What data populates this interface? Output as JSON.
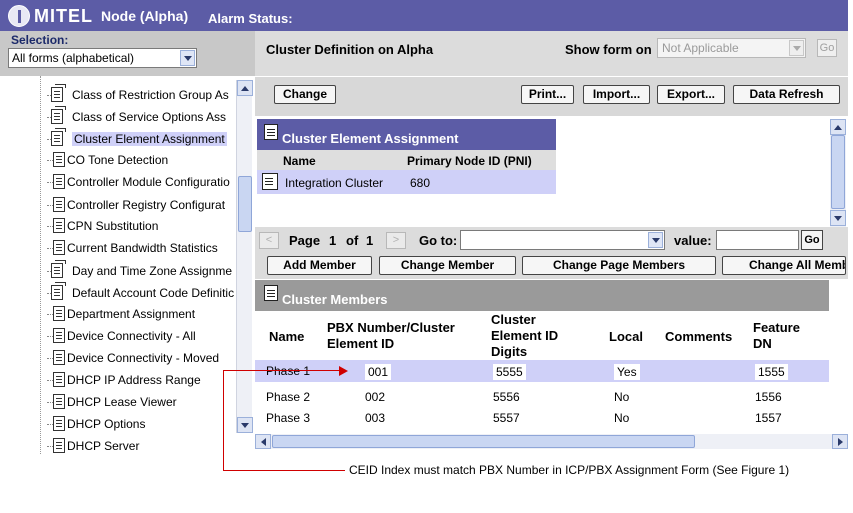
{
  "header": {
    "logo": "MITEL",
    "node_title": "Node (Alpha)",
    "alarm_status_label": "Alarm Status:"
  },
  "selection": {
    "label": "Selection:",
    "value": "All forms (alphabetical)"
  },
  "tree_items": [
    {
      "label": "Class of Restriction Group As",
      "stacked": true,
      "selected": false
    },
    {
      "label": "Class of Service Options Ass",
      "stacked": true,
      "selected": false
    },
    {
      "label": "Cluster Element Assignment",
      "stacked": true,
      "selected": true
    },
    {
      "label": "CO Tone Detection",
      "stacked": false,
      "selected": false
    },
    {
      "label": "Controller Module Configuratio",
      "stacked": false,
      "selected": false
    },
    {
      "label": "Controller Registry Configurat",
      "stacked": false,
      "selected": false
    },
    {
      "label": "CPN Substitution",
      "stacked": false,
      "selected": false
    },
    {
      "label": "Current Bandwidth Statistics",
      "stacked": false,
      "selected": false
    },
    {
      "label": "Day and Time Zone Assignme",
      "stacked": true,
      "selected": false
    },
    {
      "label": "Default Account Code Definitic",
      "stacked": true,
      "selected": false
    },
    {
      "label": "Department Assignment",
      "stacked": false,
      "selected": false
    },
    {
      "label": "Device Connectivity - All",
      "stacked": false,
      "selected": false
    },
    {
      "label": "Device Connectivity - Moved",
      "stacked": false,
      "selected": false
    },
    {
      "label": "DHCP IP Address Range",
      "stacked": false,
      "selected": false
    },
    {
      "label": "DHCP Lease Viewer",
      "stacked": false,
      "selected": false
    },
    {
      "label": "DHCP Options",
      "stacked": false,
      "selected": false
    },
    {
      "label": "DHCP Server",
      "stacked": false,
      "selected": false
    }
  ],
  "form": {
    "title": "Cluster Definition on Alpha",
    "show_form_label": "Show form on",
    "show_form_value": "Not Applicable",
    "go_label": "Go"
  },
  "toolbar": {
    "change": "Change",
    "print": "Print...",
    "import": "Import...",
    "export": "Export...",
    "refresh": "Data Refresh"
  },
  "cea": {
    "title": "Cluster Element Assignment",
    "col_name": "Name",
    "col_pni": "Primary Node ID (PNI)",
    "row_name": "Integration Cluster",
    "row_pni": "680"
  },
  "paging": {
    "prev": "<",
    "next": ">",
    "page_label": "Page",
    "page": "1",
    "of_label": "of",
    "total": "1",
    "goto_label": "Go to:",
    "value_label": "value:",
    "go": "Go"
  },
  "member_buttons": {
    "add": "Add Member",
    "change": "Change Member",
    "change_page": "Change Page Members",
    "change_all": "Change All Memb"
  },
  "members": {
    "title": "Cluster Members",
    "headers": {
      "name": "Name",
      "pbx_line1": "PBX Number/Cluster",
      "pbx_line2": "Element ID",
      "ceid_line1": "Cluster",
      "ceid_line2": "Element ID",
      "ceid_line3": "Digits",
      "local": "Local",
      "comments": "Comments",
      "feature_line1": "Feature",
      "feature_line2": "DN"
    },
    "rows": [
      {
        "name": "Phase 1",
        "pbx": "001",
        "digits": "5555",
        "local": "Yes",
        "comments": "",
        "feature_dn": "1555"
      },
      {
        "name": "Phase 2",
        "pbx": "002",
        "digits": "5556",
        "local": "No",
        "comments": "",
        "feature_dn": "1556"
      },
      {
        "name": "Phase 3",
        "pbx": "003",
        "digits": "5557",
        "local": "No",
        "comments": "",
        "feature_dn": "1557"
      }
    ]
  },
  "annotation": "CEID Index must match PBX Number in ICP/PBX Assignment Form (See Figure 1)",
  "colors": {
    "header_bg": "#5c5ca6",
    "selected_row": "#cfd0f8",
    "annotation_line": "#d00000"
  }
}
